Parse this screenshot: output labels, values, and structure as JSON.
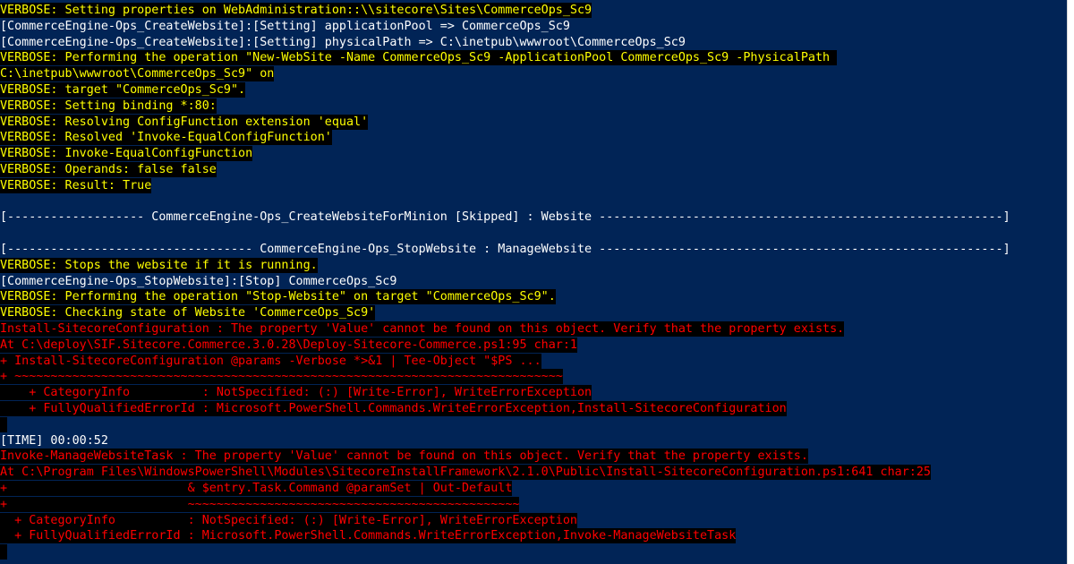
{
  "console": {
    "background": "#012456",
    "lines": [
      {
        "text": "VERBOSE: Setting properties on WebAdministration::\\\\sitecore\\Sites\\CommerceOps_Sc9",
        "kind": "verbose"
      },
      {
        "text": "[CommerceEngine-Ops_CreateWebsite]:[Setting] applicationPool => CommerceOps_Sc9",
        "kind": "info"
      },
      {
        "text": "[CommerceEngine-Ops_CreateWebsite]:[Setting] physicalPath => C:\\inetpub\\wwwroot\\CommerceOps_Sc9",
        "kind": "info"
      },
      {
        "text": "VERBOSE: Performing the operation \"New-WebSite -Name CommerceOps_Sc9 -ApplicationPool CommerceOps_Sc9 -PhysicalPath ",
        "kind": "verbose"
      },
      {
        "text": "C:\\inetpub\\wwwroot\\CommerceOps_Sc9\" on",
        "kind": "verbose"
      },
      {
        "text": "VERBOSE: target \"CommerceOps_Sc9\".",
        "kind": "verbose"
      },
      {
        "text": "VERBOSE: Setting binding *:80:",
        "kind": "verbose"
      },
      {
        "text": "VERBOSE: Resolving ConfigFunction extension 'equal'",
        "kind": "verbose"
      },
      {
        "text": "VERBOSE: Resolved 'Invoke-EqualConfigFunction'",
        "kind": "verbose"
      },
      {
        "text": "VERBOSE: Invoke-EqualConfigFunction",
        "kind": "verbose"
      },
      {
        "text": "VERBOSE: Operands: false false",
        "kind": "verbose"
      },
      {
        "text": "VERBOSE: Result: True",
        "kind": "verbose"
      },
      {
        "text": "",
        "kind": "info"
      },
      {
        "text": "[------------------- CommerceEngine-Ops_CreateWebsiteForMinion [Skipped] : Website --------------------------------------------------------]",
        "kind": "info"
      },
      {
        "text": "",
        "kind": "info"
      },
      {
        "text": "[---------------------------------- CommerceEngine-Ops_StopWebsite : ManageWebsite --------------------------------------------------------]",
        "kind": "info"
      },
      {
        "text": "VERBOSE: Stops the website if it is running.",
        "kind": "verbose"
      },
      {
        "text": "[CommerceEngine-Ops_StopWebsite]:[Stop] CommerceOps_Sc9",
        "kind": "info"
      },
      {
        "text": "VERBOSE: Performing the operation \"Stop-Website\" on target \"CommerceOps_Sc9\".",
        "kind": "verbose"
      },
      {
        "text": "VERBOSE: Checking state of Website 'CommerceOps_Sc9'",
        "kind": "verbose"
      },
      {
        "text": "Install-SitecoreConfiguration : The property 'Value' cannot be found on this object. Verify that the property exists.",
        "kind": "error"
      },
      {
        "text": "At C:\\deploy\\SIF.Sitecore.Commerce.3.0.28\\Deploy-Sitecore-Commerce.ps1:95 char:1",
        "kind": "error"
      },
      {
        "text": "+ Install-SitecoreConfiguration @params -Verbose *>&1 | Tee-Object \"$PS ...",
        "kind": "error"
      },
      {
        "text": "+ ~~~~~~~~~~~~~~~~~~~~~~~~~~~~~~~~~~~~~~~~~~~~~~~~~~~~~~~~~~~~~~~~~~~~~~~~~~~~",
        "kind": "error"
      },
      {
        "text": "    + CategoryInfo          : NotSpecified: (:) [Write-Error], WriteErrorException",
        "kind": "error"
      },
      {
        "text": "    + FullyQualifiedErrorId : Microsoft.PowerShell.Commands.WriteErrorException,Install-SitecoreConfiguration",
        "kind": "error"
      },
      {
        "text": " ",
        "kind": "error"
      },
      {
        "text": "[TIME] 00:00:52",
        "kind": "info"
      },
      {
        "text": "Invoke-ManageWebsiteTask : The property 'Value' cannot be found on this object. Verify that the property exists.",
        "kind": "error"
      },
      {
        "text": "At C:\\Program Files\\WindowsPowerShell\\Modules\\SitecoreInstallFramework\\2.1.0\\Public\\Install-SitecoreConfiguration.ps1:641 char:25",
        "kind": "error"
      },
      {
        "text": "+                         & $entry.Task.Command @paramSet | Out-Default",
        "kind": "error"
      },
      {
        "text": "+                         ~~~~~~~~~~~~~~~~~~~~~~~~~~~~~~~~~~~~~~~~~~~~~~",
        "kind": "error"
      },
      {
        "text": "  + CategoryInfo          : NotSpecified: (:) [Write-Error], WriteErrorException",
        "kind": "error"
      },
      {
        "text": "  + FullyQualifiedErrorId : Microsoft.PowerShell.Commands.WriteErrorException,Invoke-ManageWebsiteTask",
        "kind": "error"
      },
      {
        "text": " ",
        "kind": "error"
      }
    ]
  }
}
